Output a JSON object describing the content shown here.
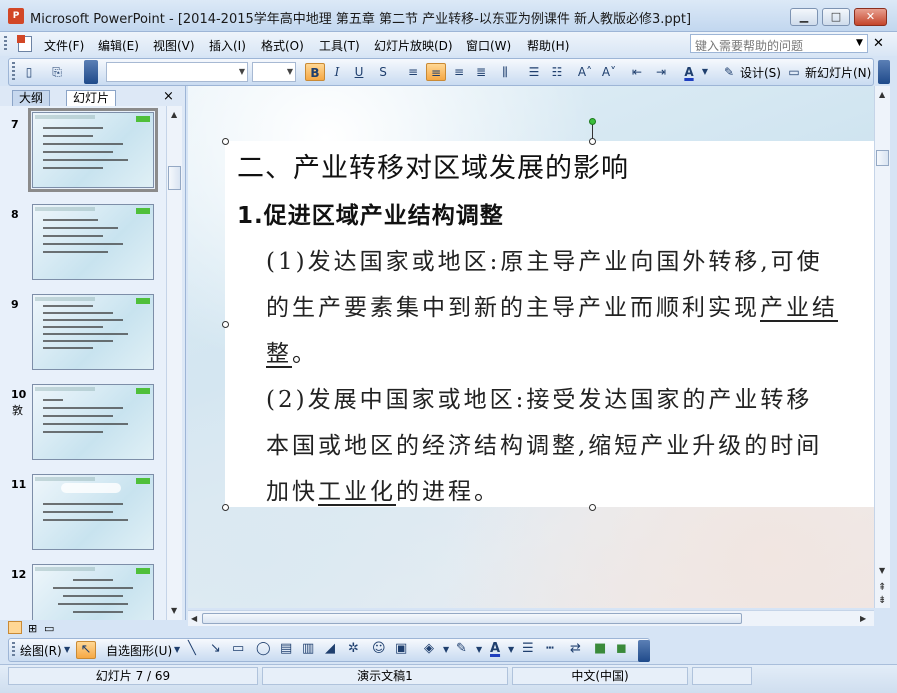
{
  "window": {
    "app_icon": "P",
    "title": "Microsoft PowerPoint - [2014-2015学年高中地理 第五章 第二节 产业转移-以东亚为例课件 新人教版必修3.ppt]"
  },
  "menu": {
    "items": [
      "文件(F)",
      "编辑(E)",
      "视图(V)",
      "插入(I)",
      "格式(O)",
      "工具(T)",
      "幻灯片放映(D)",
      "窗口(W)",
      "帮助(H)"
    ],
    "help_placeholder": "键入需要帮助的问题"
  },
  "toolbar": {
    "font_name": "",
    "font_size": "",
    "design_label": "设计(S)",
    "new_slide_label": "新幻灯片(N)",
    "bold_label": "B",
    "italic_label": "I",
    "underline_label": "U",
    "shadow_label": "S",
    "font_color_label": "A"
  },
  "left_panel": {
    "tabs": [
      "大纲",
      "幻灯片"
    ],
    "selected_tab": "幻灯片",
    "close_label": "×",
    "slide_numbers": [
      "7",
      "8",
      "9",
      "10",
      "11",
      "12"
    ],
    "selected_slide": "7",
    "partial_label": "敦"
  },
  "slide": {
    "title": "二、产业转移对区域发展的影响",
    "subtitle": "1.促进区域产业结构调整",
    "p1_line1": "(1)发达国家或地区:原主导产业向国外转移,可使",
    "p1_line2_prefix": "的生产要素集中到新的主导产业而顺利实现",
    "p1_line2_underlined": "产业结",
    "p1_line3_underlined": "整",
    "p1_line3_suffix": "。",
    "p2_line1": "(2)发展中国家或地区:接受发达国家的产业转移",
    "p2_line2": "本国或地区的经济结构调整,缩短产业升级的时间",
    "p2_line3_prefix": "加快",
    "p2_line3_underlined": "工业化",
    "p2_line3_suffix": "的进程。"
  },
  "drawing_toolbar": {
    "draw_label": "绘图(R)",
    "autoshapes_label": "自选图形(U)"
  },
  "statusbar": {
    "slide_indicator": "幻灯片 7 / 69",
    "design_name": "演示文稿1",
    "language": "中文(中国)"
  },
  "colors": {
    "accent": "#f6a845",
    "window_frame": "#c2d7ef",
    "rotate_handle": "#3cbf3c",
    "font_color_bar": "#1f3fbf"
  }
}
